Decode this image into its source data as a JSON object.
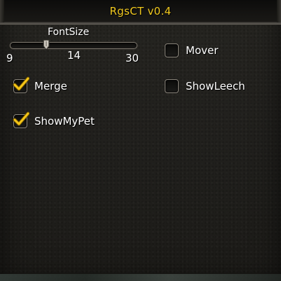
{
  "window": {
    "title": "RgsCT v0.4"
  },
  "font_size_slider": {
    "label": "FontSize",
    "min_label": "9",
    "max_label": "30",
    "value_label": "14",
    "min": 9,
    "max": 30,
    "value": 14
  },
  "options": {
    "mover": {
      "label": "Mover",
      "checked": false
    },
    "merge": {
      "label": "Merge",
      "checked": true
    },
    "show_leech": {
      "label": "ShowLeech",
      "checked": false
    },
    "show_my_pet": {
      "label": "ShowMyPet",
      "checked": true
    }
  },
  "colors": {
    "title": "#f0c81e",
    "check": "#f5c518",
    "text": "#ffffff",
    "panel": "#22211e"
  }
}
